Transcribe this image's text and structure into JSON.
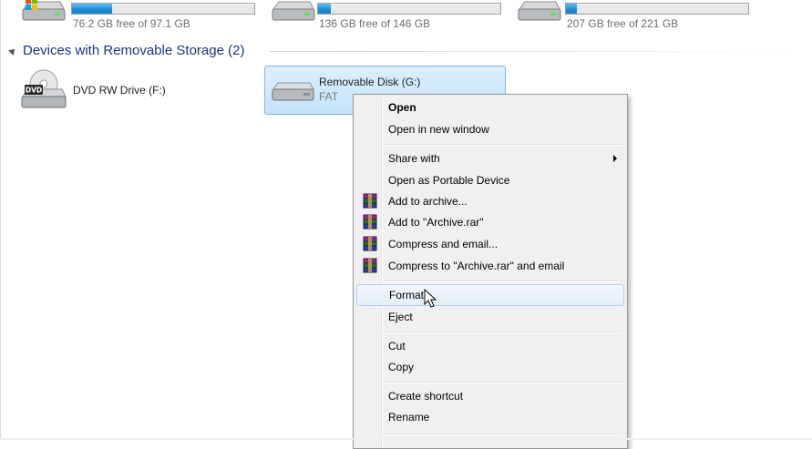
{
  "top_drives": [
    {
      "free_text": "76.2 GB free of 97.1 GB",
      "used_fraction": 0.22,
      "icon": "windows-hard-drive-icon"
    },
    {
      "free_text": "136 GB free of 146 GB",
      "used_fraction": 0.07,
      "icon": "hard-drive-icon"
    },
    {
      "free_text": "207 GB free of 221 GB",
      "used_fraction": 0.06,
      "icon": "hard-drive-icon"
    }
  ],
  "removable_group": {
    "header": "Devices with Removable Storage (2)"
  },
  "devices": {
    "dvd": {
      "label": "DVD RW Drive (F:)",
      "badge": "DVD",
      "icon": "dvd-drive-icon"
    },
    "removable": {
      "name": "Removable Disk (G:)",
      "filesystem": "FAT",
      "icon": "removable-disk-icon"
    }
  },
  "context_menu": {
    "open": "Open",
    "open_new_window": "Open in new window",
    "share_with": "Share with",
    "open_portable": "Open as Portable Device",
    "add_archive": "Add to archive...",
    "add_archive_rar": "Add to \"Archive.rar\"",
    "compress_email": "Compress and email...",
    "compress_rar_email": "Compress to \"Archive.rar\" and email",
    "format": "Format...",
    "eject": "Eject",
    "cut": "Cut",
    "copy": "Copy",
    "create_shortcut": "Create shortcut",
    "rename": "Rename"
  },
  "colors": {
    "accent": "#1e8fd6",
    "group_header": "#1e3287",
    "selection": "#c3e3fb"
  }
}
